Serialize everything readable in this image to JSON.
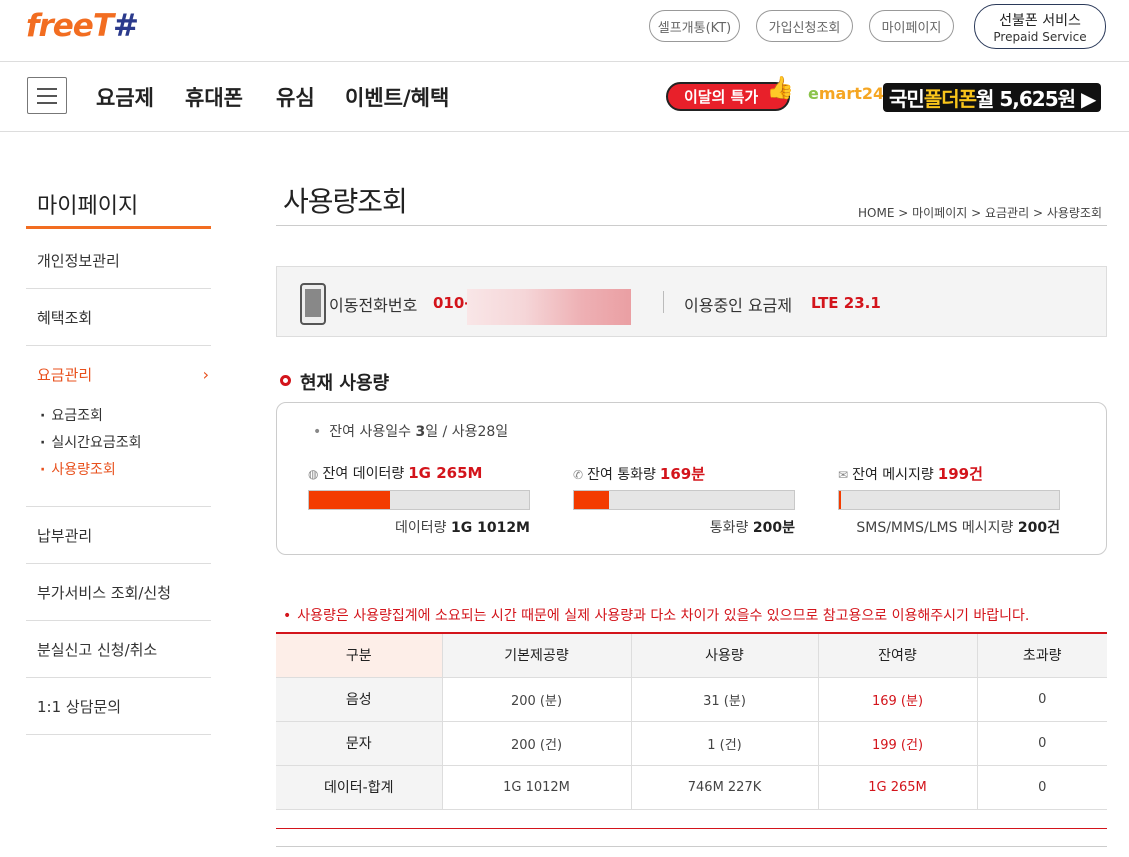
{
  "header": {
    "logo": "freeT",
    "logo_hash": "#",
    "links": [
      "셀프개통(KT)",
      "가입신청조회",
      "마이페이지"
    ],
    "prepaid_title": "선불폰 서비스",
    "prepaid_sub": "Prepaid Service"
  },
  "nav": {
    "items": [
      "요금제",
      "휴대폰",
      "유심",
      "이벤트/혜택"
    ],
    "promo1": "이달의 특가",
    "emart_e": "e",
    "emart_rest": "mart24",
    "promo2_a": "국민",
    "promo2_b": "폴더폰",
    "promo2_c": " 월 5,625원 ▶"
  },
  "sidebar": {
    "title": "마이페이지",
    "items": [
      "개인정보관리",
      "혜택조회",
      "요금관리",
      "납부관리",
      "부가서비스 조회/신청",
      "분실신고 신청/취소",
      "1:1 상담문의"
    ],
    "chevron": "›",
    "sub_items": [
      "요금조회",
      "실시간요금조회",
      "사용량조회"
    ]
  },
  "main": {
    "title": "사용량조회",
    "breadcrumb": "HOME > 마이페이지 > 요금관리 > 사용량조회",
    "phone_label": "이동전화번호",
    "phone_value": "010-4",
    "plan_label": "이용중인 요금제",
    "plan_value": "LTE 23.1",
    "section_title": "현재 사용량",
    "days_prefix": "잔여 사용일수 ",
    "days_remaining": "3",
    "days_suffix": "일 / 사용28일",
    "metrics": [
      {
        "icon": "globe-icon",
        "glyph": "◍",
        "label": "잔여 데이터량",
        "value": "1G 265M",
        "total_label": "데이터량 ",
        "total": "1G 1012M",
        "fill_fraction": 0.37
      },
      {
        "icon": "phone-icon",
        "glyph": "✆",
        "label": "잔여 통화량",
        "value": "169분",
        "total_label": "통화량 ",
        "total": "200분",
        "fill_fraction": 0.16
      },
      {
        "icon": "mail-icon",
        "glyph": "✉",
        "label": "잔여 메시지량",
        "value": "199건",
        "total_label": "SMS/MMS/LMS 메시지량 ",
        "total": "200건",
        "fill_fraction": 0.01
      }
    ],
    "notice": "사용량은 사용량집계에 소요되는 시간 때문에 실제 사용량과 다소 차이가 있을수 있으므로 참고용으로 이용해주시기 바랍니다.",
    "table": {
      "headers": [
        "구분",
        "기본제공량",
        "사용량",
        "잔여량",
        "초과량"
      ],
      "rows": [
        [
          "음성",
          "200 (분)",
          "31 (분)",
          "169 (분)",
          "0"
        ],
        [
          "문자",
          "200 (건)",
          "1 (건)",
          "199 (건)",
          "0"
        ],
        [
          "데이터-합계",
          "1G 1012M",
          "746M 227K",
          "1G 265M",
          "0"
        ]
      ]
    }
  },
  "colors": {
    "brand": "#f26d21",
    "accent_red": "#d3141b",
    "bar_fill": "#f33b00"
  }
}
